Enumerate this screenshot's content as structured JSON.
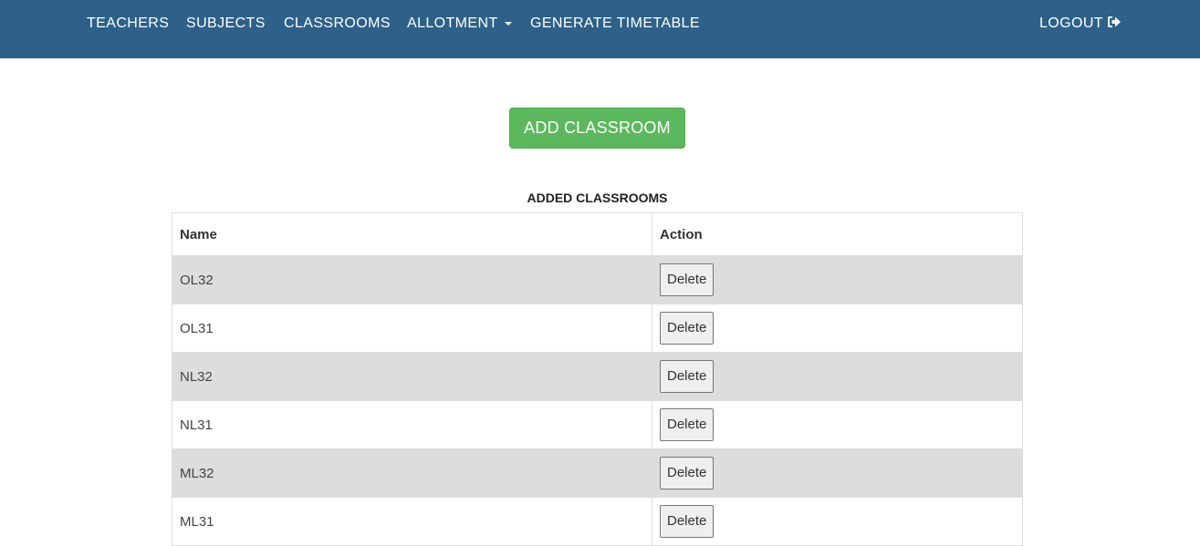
{
  "nav": {
    "teachers": "TEACHERS",
    "subjects": "SUBJECTS",
    "classrooms": "CLASSROOMS",
    "allotment": "ALLOTMENT",
    "generate_timetable": "GENERATE TIMETABLE",
    "logout": "LOGOUT",
    "background_color": "#2d6189"
  },
  "add_button": {
    "label": "ADD CLASSROOM",
    "color": "#5cb85c"
  },
  "table": {
    "title": "ADDED CLASSROOMS",
    "headers": [
      "Name",
      "Action"
    ],
    "rows": [
      {
        "name": "OL32",
        "action": "Delete"
      },
      {
        "name": "OL31",
        "action": "Delete"
      },
      {
        "name": "NL32",
        "action": "Delete"
      },
      {
        "name": "NL31",
        "action": "Delete"
      },
      {
        "name": "ML32",
        "action": "Delete"
      },
      {
        "name": "ML31",
        "action": "Delete"
      }
    ]
  }
}
